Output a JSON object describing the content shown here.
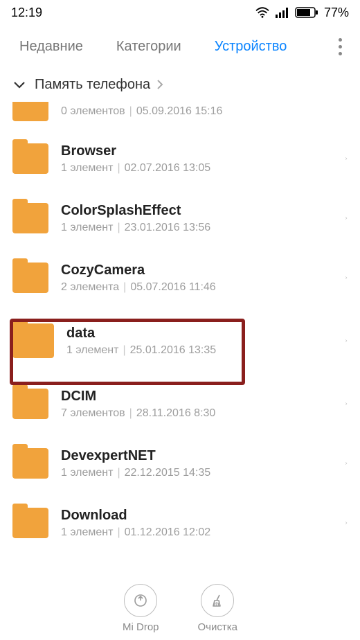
{
  "status": {
    "time": "12:19",
    "battery": "77%"
  },
  "tabs": {
    "recent": "Недавние",
    "categories": "Категории",
    "storage": "Устройство"
  },
  "breadcrumb": {
    "label": "Память телефона"
  },
  "rows": [
    {
      "name": "",
      "count": "0 элементов",
      "date": "05.09.2016 15:16"
    },
    {
      "name": "Browser",
      "count": "1 элемент",
      "date": "02.07.2016 13:05"
    },
    {
      "name": "ColorSplashEffect",
      "count": "1 элемент",
      "date": "23.01.2016 13:56"
    },
    {
      "name": "CozyCamera",
      "count": "2 элемента",
      "date": "05.07.2016 11:46"
    },
    {
      "name": "data",
      "count": "1 элемент",
      "date": "25.01.2016 13:35"
    },
    {
      "name": "DCIM",
      "count": "7 элементов",
      "date": "28.11.2016 8:30"
    },
    {
      "name": "DevexpertNET",
      "count": "1 элемент",
      "date": "22.12.2015 14:35"
    },
    {
      "name": "Download",
      "count": "1 элемент",
      "date": "01.12.2016 12:02"
    }
  ],
  "bottom": {
    "midrop": "Mi Drop",
    "clean": "Очистка"
  }
}
